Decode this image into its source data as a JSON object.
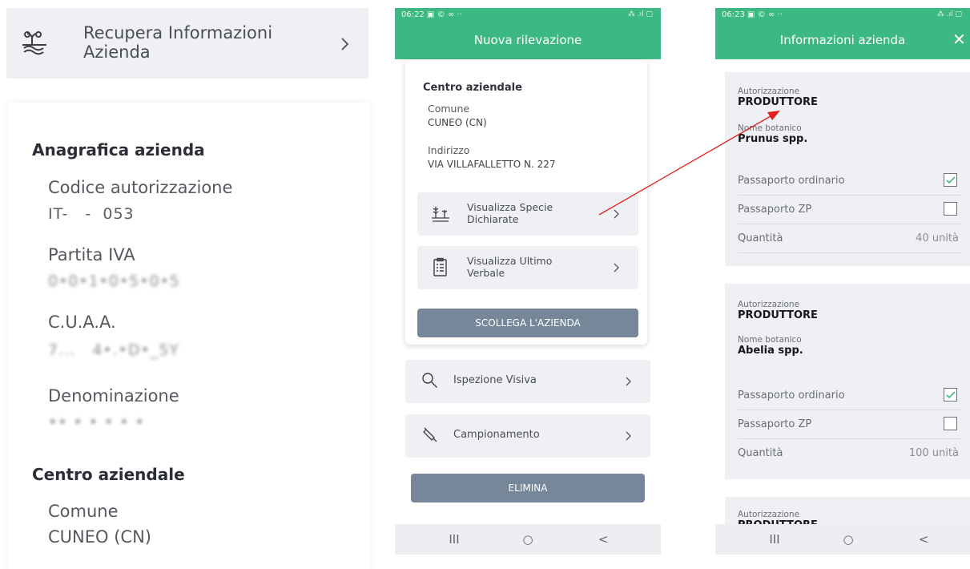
{
  "left": {
    "recupera_label": "Recupera Informazioni Azienda",
    "section_anagrafica": "Anagrafica azienda",
    "codice_label": "Codice autorizzazione",
    "codice_value": "IT-   -  053",
    "piva_label": "Partita IVA",
    "piva_value": "0•0•1•0•5•0•5",
    "cuaa_label": "C.U.A.A.",
    "cuaa_value": "7...   4•.•D•_5Y",
    "denominazione_label": "Denominazione",
    "denominazione_value": "•• • • • • •",
    "section_centro": "Centro aziendale",
    "comune_label": "Comune",
    "comune_value": "CUNEO (CN)"
  },
  "phone1": {
    "status_time": "06:22",
    "status_icons": "▣ © ∞ ··",
    "status_right": "⁂ .ıl ▢",
    "title": "Nuova rilevazione",
    "section": "Centro aziendale",
    "comune_label": "Comune",
    "comune_value": "CUNEO (CN)",
    "indirizzo_label": "Indirizzo",
    "indirizzo_value": "VIA VILLAFALLETTO N. 227",
    "btn_specie": "Visualizza Specie Dichiarate",
    "btn_verbale": "Visualizza Ultimo Verbale",
    "btn_scollega": "SCOLLEGA L'AZIENDA",
    "item_ispezione": "Ispezione Visiva",
    "item_campionamento": "Campionamento",
    "btn_elimina": "ELIMINA",
    "nav_recent": "III",
    "nav_home": "○",
    "nav_back": "<"
  },
  "phone2": {
    "status_time": "06:23",
    "status_icons": "▣ © ∞ ··",
    "status_right": "⁂ .ıl ▢",
    "title": "Informazioni azienda",
    "close": "✕",
    "cards": [
      {
        "aut_label": "Autorizzazione",
        "aut_value": "PRODUTTORE",
        "nome_label": "Nome botanico",
        "nome_value": "Prunus spp.",
        "pass_ord_label": "Passaporto ordinario",
        "pass_ord_checked": true,
        "pass_zp_label": "Passaporto ZP",
        "pass_zp_checked": false,
        "qta_label": "Quantità",
        "qta_value": "40 unità"
      },
      {
        "aut_label": "Autorizzazione",
        "aut_value": "PRODUTTORE",
        "nome_label": "Nome botanico",
        "nome_value": "Abelia spp.",
        "pass_ord_label": "Passaporto ordinario",
        "pass_ord_checked": true,
        "pass_zp_label": "Passaporto ZP",
        "pass_zp_checked": false,
        "qta_label": "Quantità",
        "qta_value": "100 unità"
      },
      {
        "aut_label": "Autorizzazione",
        "aut_value": "PRODUTTORE"
      }
    ],
    "nav_recent": "III",
    "nav_home": "○",
    "nav_back": "<"
  },
  "colors": {
    "brand_green": "#3cb883",
    "button_grey": "#76879a",
    "card_bg": "#eef0f3",
    "annotation_arrow": "#e0201c"
  }
}
